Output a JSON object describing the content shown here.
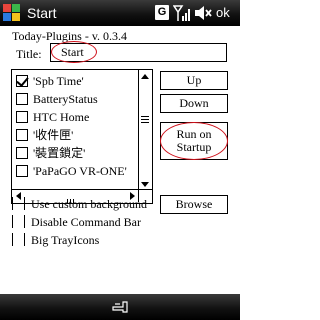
{
  "statusbar": {
    "title": "Start",
    "badge": "G",
    "ok_label": "ok",
    "icons": [
      "windows-start-icon",
      "signal-icon",
      "volume-muted-icon"
    ]
  },
  "heading": "Today-Plugins - v. 0.3.4",
  "title_field": {
    "label": "Title:",
    "value": "Start"
  },
  "plugins": {
    "items": [
      {
        "label": "'Spb Time'",
        "checked": true
      },
      {
        "label": "BatteryStatus",
        "checked": false
      },
      {
        "label": "HTC Home",
        "checked": false
      },
      {
        "label": "'收件匣'",
        "checked": false
      },
      {
        "label": "'裝置鎖定'",
        "checked": false
      },
      {
        "label": "'PaPaGO VR-ONE'",
        "checked": false
      }
    ]
  },
  "buttons": {
    "up": "Up",
    "down": "Down",
    "run_line1": "Run on",
    "run_line2": "Startup",
    "browse": "Browse"
  },
  "options": [
    {
      "label": "Use custom background"
    },
    {
      "label": "Disable Command Bar"
    },
    {
      "label": "Big TrayIcons"
    }
  ],
  "colors": {
    "bar_dark": "#000000",
    "highlight": "#d0101a"
  }
}
